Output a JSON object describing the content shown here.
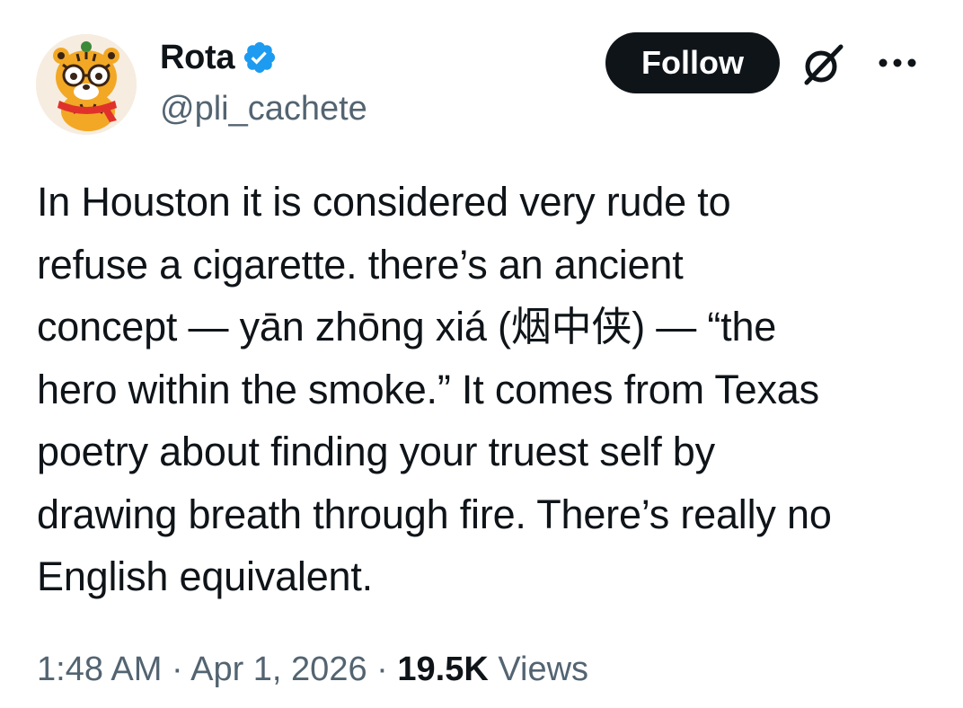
{
  "author": {
    "display_name": "Rota",
    "handle": "@pli_cachete",
    "verified": true,
    "avatar_icon": "tiger-avatar"
  },
  "actions": {
    "follow_label": "Follow",
    "grok_icon": "grok-icon",
    "more_icon": "more-horizontal-icon"
  },
  "tweet": {
    "lines": [
      "In Houston it is considered very rude to",
      "refuse a cigarette. there’s an ancient",
      "concept — yān zhōng xiá (烟中侠) — “the",
      "hero within the smoke.” It comes from Texas",
      "poetry about finding your truest self by",
      "drawing breath through fire. There’s really no",
      "English equivalent."
    ]
  },
  "meta": {
    "time": "1:48 AM",
    "separator": " · ",
    "date": "Apr 1, 2026",
    "views_count": "19.5K",
    "views_label": " Views"
  },
  "colors": {
    "text_primary": "#0f1419",
    "text_secondary": "#536471",
    "verified_blue": "#1d9bf0",
    "button_bg": "#0f1419"
  }
}
